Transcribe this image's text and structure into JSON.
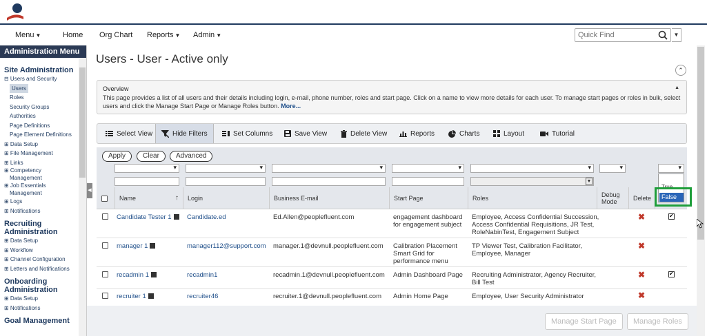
{
  "nav": {
    "menu": "Menu",
    "home": "Home",
    "org_chart": "Org Chart",
    "reports": "Reports",
    "admin": "Admin"
  },
  "quick_find": {
    "placeholder": "Quick Find"
  },
  "sidebar": {
    "header": "Administration Menu",
    "site_admin": "Site Administration",
    "users_security": "⊟ Users and Security",
    "users": "Users",
    "roles": "Roles",
    "security_groups": "Security Groups",
    "authorities": "Authorities",
    "page_definitions": "Page Definitions",
    "page_element_definitions": "Page Element Definitions",
    "data_setup": "⊞ Data Setup",
    "file_management": "⊞ File Management",
    "links": "⊞ Links",
    "competency": "⊞ Competency",
    "competency_2": "Management",
    "job_essentials": "⊞ Job Essentials",
    "job_essentials_2": "Management",
    "logs": "⊞ Logs",
    "notifications": "⊞ Notifications",
    "recruiting_admin": "Recruiting",
    "recruiting_admin_2": "Administration",
    "rec_data_setup": "⊞ Data Setup",
    "rec_workflow": "⊞ Workflow",
    "rec_channel": "⊞ Channel Configuration",
    "rec_letters": "⊞ Letters and Notifications",
    "onboarding_admin": "Onboarding",
    "onboarding_admin_2": "Administration",
    "onb_data_setup": "⊞ Data Setup",
    "onb_notifications": "⊞ Notifications",
    "goal_management": "Goal Management"
  },
  "page": {
    "title": "Users - User - Active only",
    "overview_title": "Overview",
    "overview_text": "This page provides a list of all users and their details including login, e-mail, phone number, roles and start page. Click on a name to view more details for each user. To manage start pages or roles in bulk, select users and click the Manage Start Page or Manage Roles button.",
    "overview_more": "More..."
  },
  "toolbar": {
    "select_view": "Select View",
    "hide_filters": "Hide Filters",
    "set_columns": "Set Columns",
    "save_view": "Save View",
    "delete_view": "Delete View",
    "reports": "Reports",
    "charts": "Charts",
    "layout": "Layout",
    "tutorial": "Tutorial"
  },
  "filters": {
    "apply": "Apply",
    "clear": "Clear",
    "advanced": "Advanced"
  },
  "columns": {
    "name": "Name",
    "login": "Login",
    "email": "Business E-mail",
    "start_page": "Start Page",
    "roles": "Roles",
    "debug_mode": "Debug Mode",
    "delete": "Delete"
  },
  "rows": [
    {
      "name": "Candidate Tester 1",
      "login": "Candidate.ed",
      "email": "Ed.Allen@peoplefluent.com",
      "start_page": "engagement dashboard for engagement subject",
      "roles": "Employee, Access Confidential Succession, Access Confidential Requisitions, JR Test, RoleNabinTest, Engagement Subject",
      "checked": true
    },
    {
      "name": "manager 1",
      "login": "manager112@support.com",
      "email": "manager.1@devnull.peoplefluent.com",
      "start_page": "Calibration Placement Smart Grid for performance menu",
      "roles": "TP Viewer Test, Calibration Facilitator, Employee, Manager",
      "checked": false
    },
    {
      "name": "recadmin 1",
      "login": "recadmin1",
      "email": "recadmin.1@devnull.peoplefluent.com",
      "start_page": "Admin Dashboard Page",
      "roles": "Recruiting Administrator, Agency Recruiter, Bill Test",
      "checked": true
    },
    {
      "name": "recruiter 1",
      "login": "recruiter46",
      "email": "recruiter.1@devnull.peoplefluent.com",
      "start_page": "Admin Home Page",
      "roles": "Employee, User Security Administrator",
      "checked": false
    }
  ],
  "dropdown": {
    "option_true": "True",
    "option_false": "False"
  },
  "footer": {
    "manage_start_page": "Manage Start Page",
    "manage_roles": "Manage Roles"
  },
  "colors": {
    "accent": "#1f4f8a",
    "sidebar_header": "#2b3a55",
    "highlight": "#1e9e3a",
    "delete_x": "#c0392b"
  }
}
